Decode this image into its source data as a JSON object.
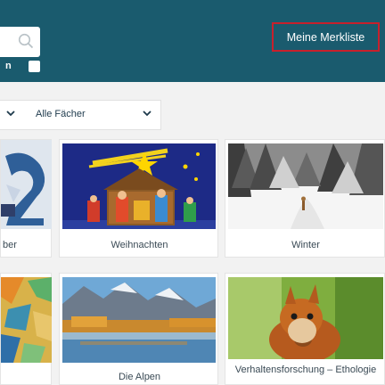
{
  "colors": {
    "header": "#1a5b6e",
    "highlight_red": "#c8202c"
  },
  "header": {
    "search_placeholder": "",
    "checkbox_label": "n",
    "merkliste_label": "Meine Merkliste"
  },
  "filter": {
    "faecher_label": "Alle Fächer"
  },
  "cards": [
    {
      "label": "ber"
    },
    {
      "label": "Weihnachten"
    },
    {
      "label": "Winter"
    },
    {
      "label": ""
    },
    {
      "label": "Die Alpen"
    },
    {
      "label": "Verhaltensforschung – Ethologie"
    }
  ]
}
